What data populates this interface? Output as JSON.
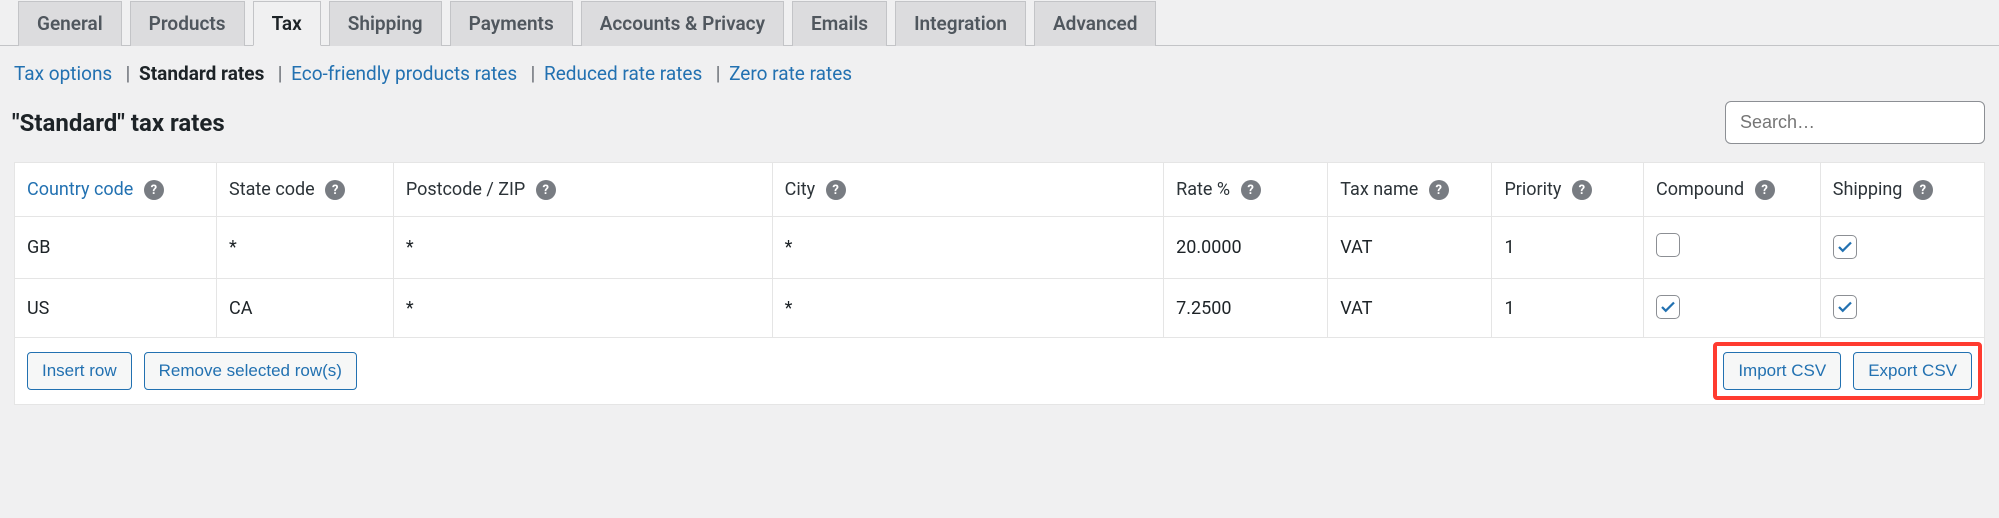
{
  "tabs": [
    {
      "label": "General",
      "active": false
    },
    {
      "label": "Products",
      "active": false
    },
    {
      "label": "Tax",
      "active": true
    },
    {
      "label": "Shipping",
      "active": false
    },
    {
      "label": "Payments",
      "active": false
    },
    {
      "label": "Accounts & Privacy",
      "active": false
    },
    {
      "label": "Emails",
      "active": false
    },
    {
      "label": "Integration",
      "active": false
    },
    {
      "label": "Advanced",
      "active": false
    }
  ],
  "subnav": {
    "tax_options": "Tax options",
    "standard_rates": "Standard rates",
    "eco_rates": "Eco-friendly products rates",
    "reduced_rates": "Reduced rate rates",
    "zero_rates": "Zero rate rates"
  },
  "page_title": "\"Standard\" tax rates",
  "search": {
    "placeholder": "Search…",
    "value": ""
  },
  "columns": {
    "country_code": "Country code",
    "state_code": "State code",
    "postcode": "Postcode / ZIP",
    "city": "City",
    "rate": "Rate %",
    "tax_name": "Tax name",
    "priority": "Priority",
    "compound": "Compound",
    "shipping": "Shipping"
  },
  "rows": [
    {
      "country": "GB",
      "state": "*",
      "postcode": "*",
      "city": "*",
      "rate": "20.0000",
      "tax_name": "VAT",
      "priority": "1",
      "compound": false,
      "shipping": true
    },
    {
      "country": "US",
      "state": "CA",
      "postcode": "*",
      "city": "*",
      "rate": "7.2500",
      "tax_name": "VAT",
      "priority": "1",
      "compound": true,
      "shipping": true
    }
  ],
  "buttons": {
    "insert_row": "Insert row",
    "remove_rows": "Remove selected row(s)",
    "import_csv": "Import CSV",
    "export_csv": "Export CSV"
  },
  "icons": {
    "help": "?"
  }
}
